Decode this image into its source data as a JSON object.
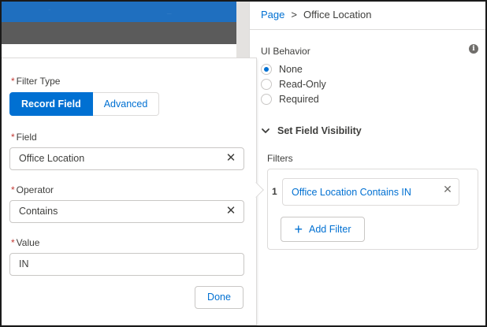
{
  "breadcrumb": {
    "parent": "Page",
    "separator": ">",
    "current": "Office Location"
  },
  "ui_behavior": {
    "label": "UI Behavior",
    "info_icon": "info-icon",
    "options": [
      {
        "label": "None",
        "selected": true
      },
      {
        "label": "Read-Only",
        "selected": false
      },
      {
        "label": "Required",
        "selected": false
      }
    ]
  },
  "visibility": {
    "header": "Set Field Visibility",
    "expanded": true,
    "filters_label": "Filters",
    "filters": [
      {
        "index": "1",
        "text": "Office Location Contains IN"
      }
    ],
    "add_filter_label": "Add Filter"
  },
  "filter_popover": {
    "filter_type": {
      "label": "Filter Type",
      "required": "*",
      "options": [
        "Record Field",
        "Advanced"
      ],
      "selected": "Record Field"
    },
    "field": {
      "label": "Field",
      "required": "*",
      "value": "Office Location"
    },
    "operator": {
      "label": "Operator",
      "required": "*",
      "value": "Contains"
    },
    "value": {
      "label": "Value",
      "required": "*",
      "value": "IN"
    },
    "done_label": "Done"
  },
  "colors": {
    "brand_blue": "#0070d2",
    "required_red": "#c23934",
    "border": "#dddbda"
  }
}
